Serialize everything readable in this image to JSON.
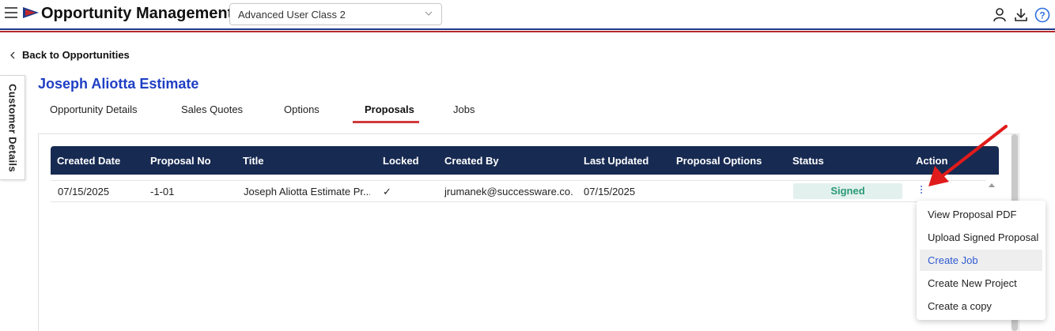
{
  "header": {
    "app_title": "Opportunity Management",
    "class_select_value": "Advanced User Class 2",
    "icons": [
      "menu-icon",
      "logo-flag-icon",
      "user-icon",
      "download-icon",
      "help-icon"
    ]
  },
  "back_link": "Back to Opportunities",
  "side_tab": "Customer Details",
  "page_title": "Joseph Aliotta Estimate",
  "tabs": [
    {
      "label": "Opportunity Details"
    },
    {
      "label": "Sales Quotes"
    },
    {
      "label": "Options"
    },
    {
      "label": "Proposals",
      "active": true
    },
    {
      "label": "Jobs"
    }
  ],
  "table": {
    "columns": [
      "Created Date",
      "Proposal No",
      "Title",
      "Locked",
      "Created By",
      "Last Updated",
      "Proposal Options",
      "Status",
      "Action"
    ],
    "rows": [
      {
        "created_date": "07/15/2025",
        "proposal_no": "-1-01",
        "title": "Joseph Aliotta Estimate Pr...",
        "locked": "✓",
        "created_by": "jrumanek@successware.co...",
        "last_updated": "07/15/2025",
        "proposal_options": "",
        "status": "Signed"
      }
    ]
  },
  "action_menu": {
    "items": [
      "View Proposal PDF",
      "Upload Signed Proposal",
      "Create Job",
      "Create New Project",
      "Create a copy"
    ],
    "highlighted": "Create Job"
  },
  "colors": {
    "brand_blue": "#1f3fc4",
    "table_header": "#172a52",
    "tab_underline": "#d03a3a",
    "status_text": "#2a9a74",
    "status_bg": "#e3f1ee",
    "arrow_red": "#e01b1b"
  }
}
